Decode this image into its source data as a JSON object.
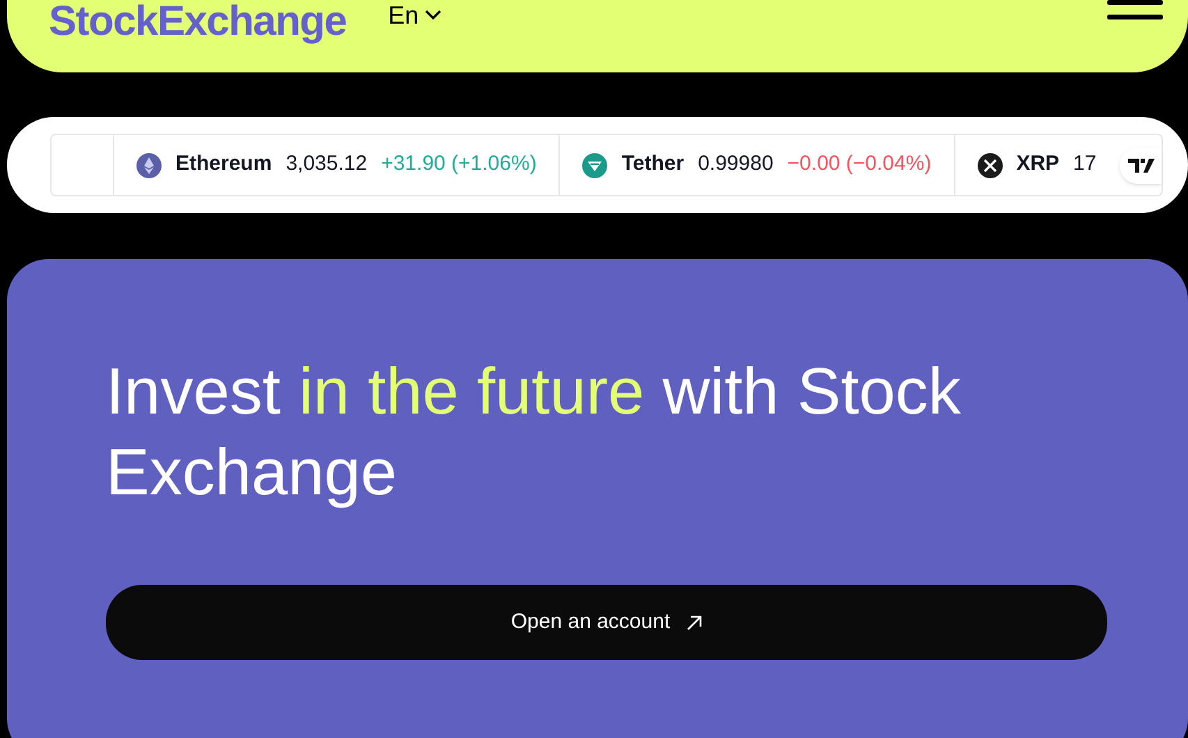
{
  "header": {
    "logo": "StockExchange",
    "language": "En"
  },
  "ticker": [
    {
      "name": "Ethereum",
      "price": "3,035.12",
      "change": "+31.90 (+1.06%)",
      "kind": "gain"
    },
    {
      "name": "Tether",
      "price": "0.99980",
      "change": "−0.00 (−0.04%)",
      "kind": "loss"
    },
    {
      "name": "XRP",
      "price": "17"
    }
  ],
  "hero": {
    "title": "Invest **in the future** with Stock Exchange",
    "button": "Open an account"
  }
}
